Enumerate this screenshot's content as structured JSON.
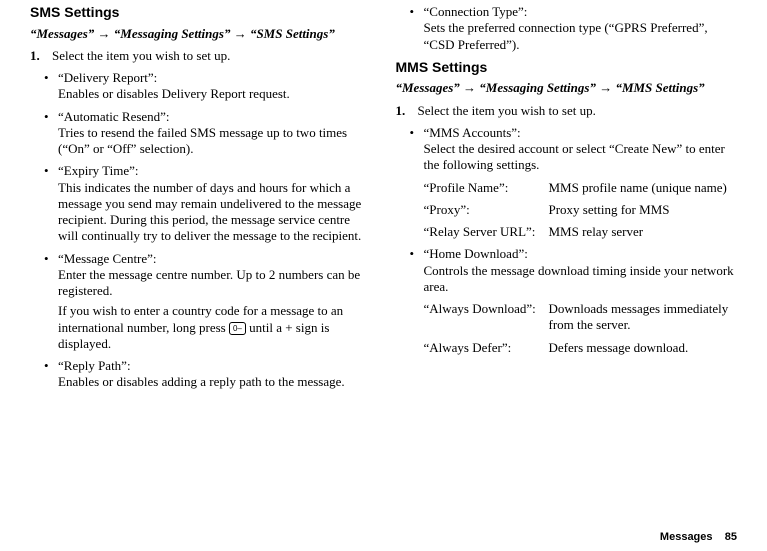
{
  "left": {
    "heading": "SMS Settings",
    "path": "“Messages” → “Messaging Settings” → “SMS Settings”",
    "step_num": "1.",
    "step_text": "Select the item you wish to set up.",
    "b1_title": "“Delivery Report”:",
    "b1_body": "Enables or disables Delivery Report request.",
    "b2_title": "“Automatic Resend”:",
    "b2_body": "Tries to resend the failed SMS message up to two times (“On” or “Off” selection).",
    "b3_title": "“Expiry Time”:",
    "b3_body": "This indicates the number of days and hours for which a message you send may remain undelivered to the message recipient. During this period, the message service centre will continually try to deliver the message to the recipient.",
    "b4_title": "“Message Centre”:",
    "b4_body": "Enter the message centre number. Up to 2 numbers can be registered.",
    "b4_extra_a": "If you wish to enter a country code for a message to an international number, long press ",
    "b4_key": "0–",
    "b4_extra_b": " until a + sign is displayed.",
    "b5_title": "“Reply Path”:",
    "b5_body": "Enables or disables adding a reply path to the message."
  },
  "right": {
    "b0_title": "“Connection Type”:",
    "b0_body": "Sets the preferred connection type (“GPRS Preferred”, “CSD Preferred”).",
    "heading": "MMS Settings",
    "path": "“Messages” → “Messaging Settings” → “MMS Settings”",
    "step_num": "1.",
    "step_text": "Select the item you wish to set up.",
    "b1_title": "“MMS Accounts”:",
    "b1_body": "Select the desired account or select “Create New” to enter the following settings.",
    "kv1_l": "“Profile Name”:",
    "kv1_v": "MMS profile name (unique name)",
    "kv2_l": "“Proxy”:",
    "kv2_v": "Proxy setting for MMS",
    "kv3_l": "“Relay Server URL”:",
    "kv3_v": "MMS relay server",
    "b2_title": "“Home Download”:",
    "b2_body": "Controls the message download timing inside your network area.",
    "kv4_l": "“Always Download”:",
    "kv4_v": "Downloads messages immediately from the server.",
    "kv5_l": "“Always Defer”:",
    "kv5_v": "Defers message download."
  },
  "footer": {
    "label": "Messages",
    "page": "85"
  }
}
